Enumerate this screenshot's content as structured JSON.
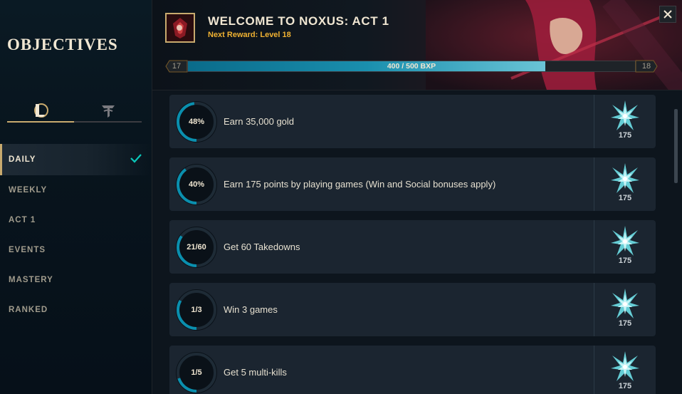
{
  "sidebar": {
    "title": "OBJECTIVES",
    "mode_tabs": [
      {
        "icon": "league-of-legends-logo-icon",
        "active": true
      },
      {
        "icon": "tft-logo-icon",
        "active": false
      }
    ],
    "items": [
      {
        "label": "DAILY",
        "active": true
      },
      {
        "label": "WEEKLY"
      },
      {
        "label": "ACT 1"
      },
      {
        "label": "EVENTS"
      },
      {
        "label": "MASTERY"
      },
      {
        "label": "RANKED"
      }
    ]
  },
  "header": {
    "title": "WELCOME TO NOXUS: ACT 1",
    "next_reward": "Next Reward: Level 18",
    "level_current": "17",
    "level_next": "18",
    "progress_text": "400 / 500 BXP",
    "progress_fraction": 0.8
  },
  "objectives": [
    {
      "progress_label": "48%",
      "progress": 0.48,
      "text": "Earn 35,000 gold",
      "reward": "175"
    },
    {
      "progress_label": "40%",
      "progress": 0.4,
      "text": "Earn 175 points by playing games (Win and Social bonuses apply)",
      "reward": "175"
    },
    {
      "progress_label": "21/60",
      "progress": 0.35,
      "text": "Get 60 Takedowns",
      "reward": "175"
    },
    {
      "progress_label": "1/3",
      "progress": 0.333,
      "text": "Win 3 games",
      "reward": "175"
    },
    {
      "progress_label": "1/5",
      "progress": 0.2,
      "text": "Get 5 multi-kills",
      "reward": "175"
    }
  ],
  "colors": {
    "gold": "#c8aa6e",
    "accent_blue": "#0ac8b9",
    "reward_gold": "#f0b232"
  }
}
